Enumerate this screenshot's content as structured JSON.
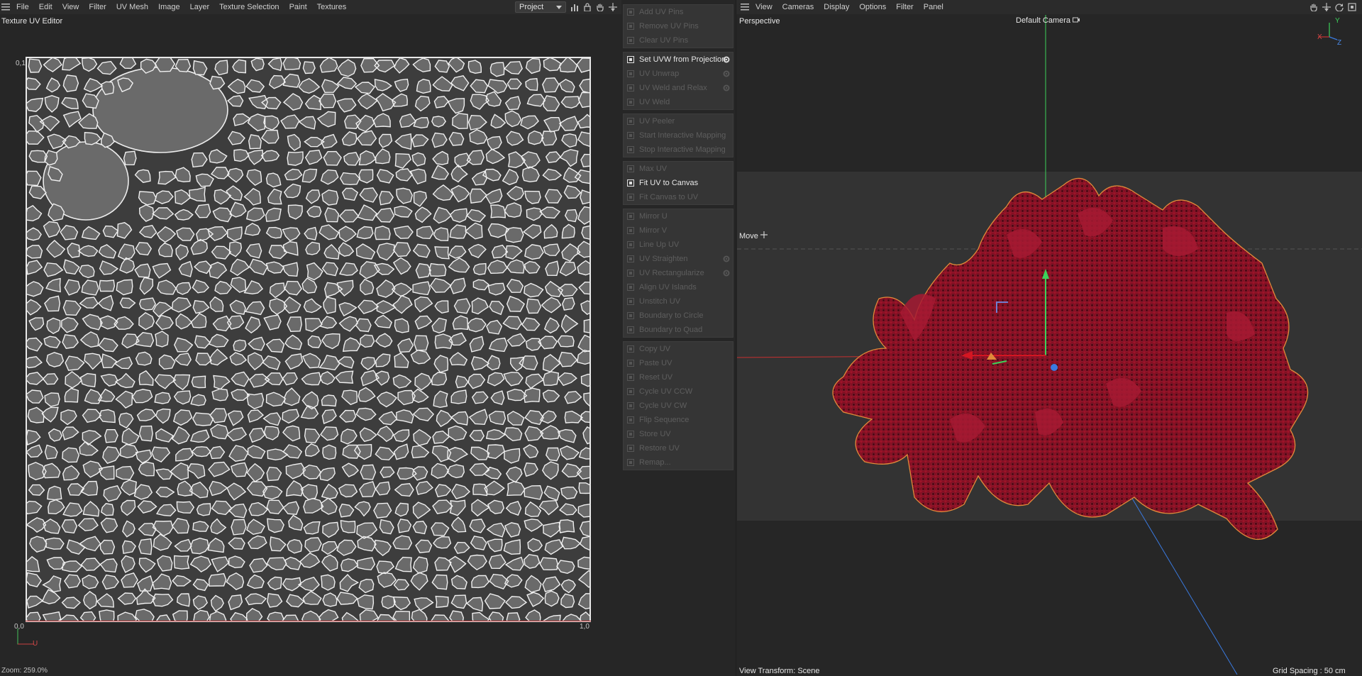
{
  "uv_editor": {
    "menu": [
      "File",
      "Edit",
      "View",
      "Filter",
      "UV Mesh",
      "Image",
      "Layer",
      "Texture Selection",
      "Paint",
      "Textures"
    ],
    "title": "Texture UV Editor",
    "project_dropdown": "Project",
    "label_top_left": "0,1",
    "label_bottom_left": "0,0",
    "label_bottom_right": "1,0",
    "axis_u": "U",
    "zoom": "Zoom: 259.0%"
  },
  "tools": {
    "groups": [
      [
        {
          "label": "Add UV Pins",
          "enabled": false,
          "icon": "pin-icon"
        },
        {
          "label": "Remove UV Pins",
          "enabled": false,
          "icon": "pin-icon"
        },
        {
          "label": "Clear UV Pins",
          "enabled": false,
          "icon": "close-icon"
        }
      ],
      [
        {
          "label": "Set UVW from Projection",
          "enabled": true,
          "icon": "projection-icon",
          "gear": true
        },
        {
          "label": "UV Unwrap",
          "enabled": false,
          "icon": "unwrap-icon",
          "gear": true
        },
        {
          "label": "UV Weld and Relax",
          "enabled": false,
          "icon": "weld-icon",
          "gear": true
        },
        {
          "label": "UV Weld",
          "enabled": false,
          "icon": "weld-icon"
        }
      ],
      [
        {
          "label": "UV Peeler",
          "enabled": false,
          "icon": "peeler-icon"
        },
        {
          "label": "Start Interactive Mapping",
          "enabled": false,
          "icon": "play-icon"
        },
        {
          "label": "Stop Interactive Mapping",
          "enabled": false,
          "icon": "stop-icon"
        }
      ],
      [
        {
          "label": "Max UV",
          "enabled": false,
          "icon": "max-icon"
        },
        {
          "label": "Fit UV to Canvas",
          "enabled": true,
          "icon": "fit-icon"
        },
        {
          "label": "Fit Canvas to UV",
          "enabled": false,
          "icon": "fit-icon"
        }
      ],
      [
        {
          "label": "Mirror U",
          "enabled": false,
          "icon": "mirror-icon"
        },
        {
          "label": "Mirror V",
          "enabled": false,
          "icon": "mirror-icon"
        },
        {
          "label": "Line Up UV",
          "enabled": false,
          "icon": "lineup-icon"
        },
        {
          "label": "UV Straighten",
          "enabled": false,
          "icon": "straighten-icon",
          "gear": true
        },
        {
          "label": "UV Rectangularize",
          "enabled": false,
          "icon": "rect-icon",
          "gear": true
        },
        {
          "label": "Align UV Islands",
          "enabled": false,
          "icon": "align-icon"
        },
        {
          "label": "Unstitch UV",
          "enabled": false,
          "icon": "unstitch-icon"
        },
        {
          "label": "Boundary to Circle",
          "enabled": false,
          "icon": "circle-icon"
        },
        {
          "label": "Boundary to Quad",
          "enabled": false,
          "icon": "quad-icon"
        }
      ],
      [
        {
          "label": "Copy UV",
          "enabled": false,
          "icon": "copy-icon"
        },
        {
          "label": "Paste UV",
          "enabled": false,
          "icon": "paste-icon"
        },
        {
          "label": "Reset UV",
          "enabled": false,
          "icon": "reset-icon"
        },
        {
          "label": "Cycle UV CCW",
          "enabled": false,
          "icon": "cycle-icon"
        },
        {
          "label": "Cycle UV CW",
          "enabled": false,
          "icon": "cycle-icon"
        },
        {
          "label": "Flip Sequence",
          "enabled": false,
          "icon": "flip-icon"
        },
        {
          "label": "Store UV",
          "enabled": false,
          "icon": "store-icon"
        },
        {
          "label": "Restore UV",
          "enabled": false,
          "icon": "restore-icon"
        },
        {
          "label": "Remap...",
          "enabled": false,
          "icon": "remap-icon"
        }
      ]
    ]
  },
  "viewport": {
    "menu": [
      "View",
      "Cameras",
      "Display",
      "Options",
      "Filter",
      "Panel"
    ],
    "view_name": "Perspective",
    "camera": "Default Camera",
    "tool_label": "Move",
    "footer_left": "View Transform: Scene",
    "footer_right": "Grid Spacing : 50 cm",
    "axis_x": "X",
    "axis_y": "Y",
    "axis_z": "Z"
  },
  "colors": {
    "accent_red": "#d41622",
    "selection_orange": "#d98a3a",
    "axis_green": "#3cd25a",
    "axis_blue": "#3a7ae0"
  }
}
